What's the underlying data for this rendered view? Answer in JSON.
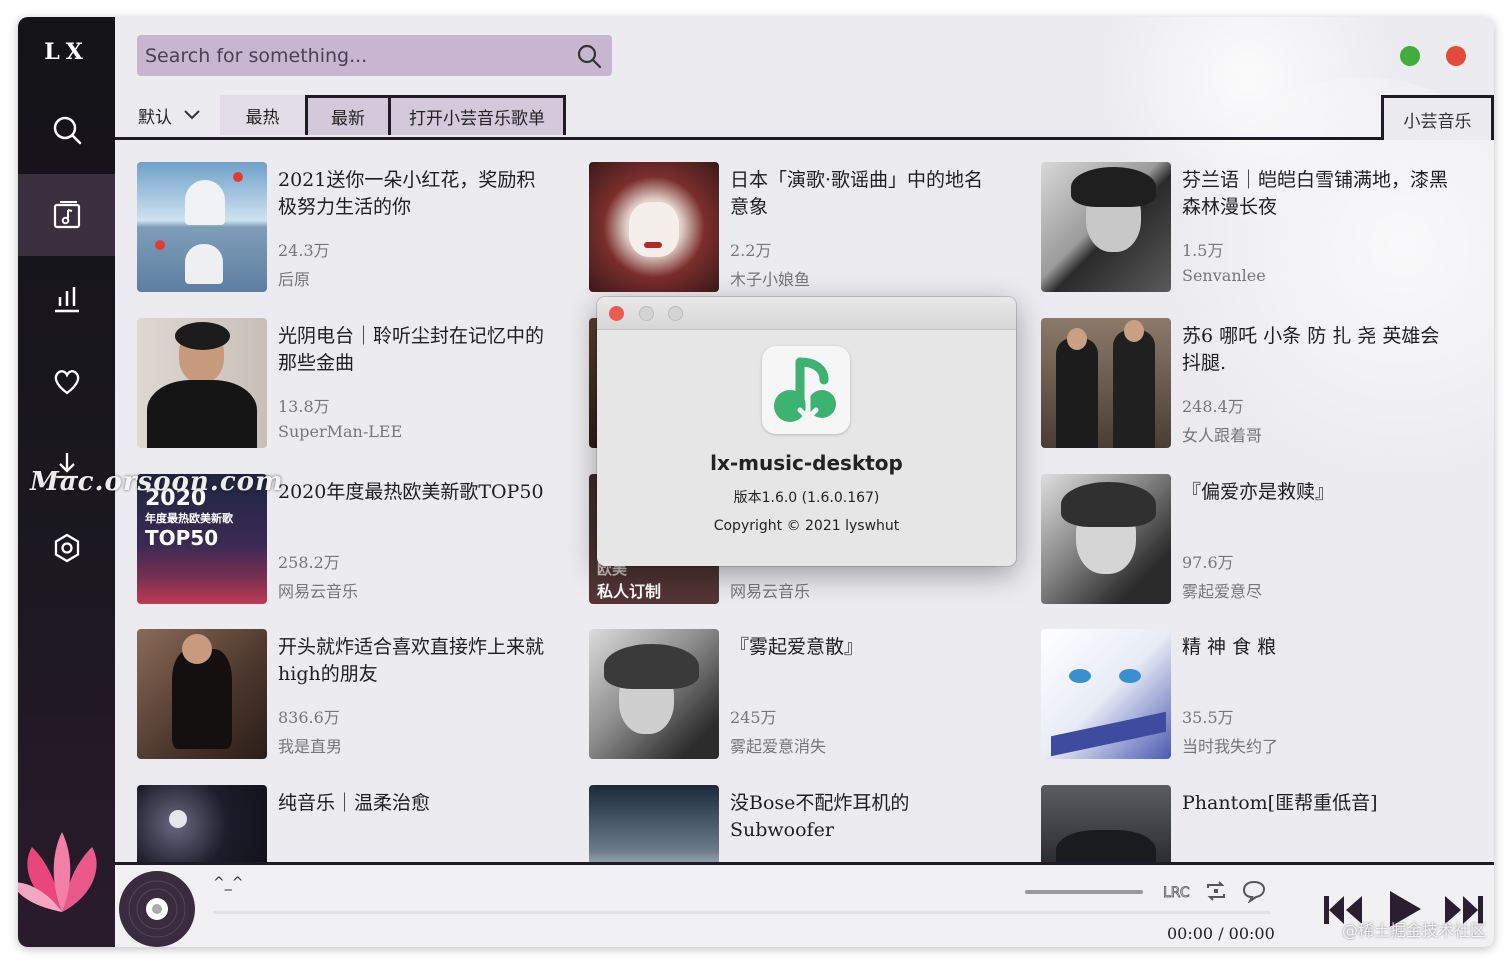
{
  "app": {
    "logo": "LX",
    "window_green": "#3fae3f",
    "window_red": "#e54b3c",
    "accent": "#c8b5cf"
  },
  "search": {
    "placeholder": "Search for something..."
  },
  "tabs": {
    "sort_label": "默认",
    "items": [
      {
        "label": "最热"
      },
      {
        "label": "最新"
      },
      {
        "label": "打开小芸音乐歌单"
      }
    ],
    "source": "小芸音乐"
  },
  "cards": [
    {
      "title": "2021送你一朵小红花，奖励积极努力生活的你",
      "count": "24.3万",
      "author": "后原"
    },
    {
      "title": "日本「演歌·歌谣曲」中的地名意象",
      "count": "2.2万",
      "author": "木子小娘鱼"
    },
    {
      "title": "芬兰语｜皑皑白雪铺满地，漆黑森林漫长夜",
      "count": "1.5万",
      "author": "Senvanlee"
    },
    {
      "title": "光阴电台｜聆听尘封在记忆中的那些金曲",
      "count": "13.8万",
      "author": "SuperMan-LEE"
    },
    {
      "title": "",
      "count": "",
      "author": ""
    },
    {
      "title": "苏6 哪吒 小条 防 扎 尧 英雄会 抖腿.",
      "count": "248.4万",
      "author": "女人跟着哥"
    },
    {
      "title": "2020年度最热欧美新歌TOP50",
      "count": "258.2万",
      "author": "网易云音乐",
      "thumb_text_1": "2020",
      "thumb_text_2": "年度最热欧美新歌",
      "thumb_text_3": "TOP50"
    },
    {
      "title": "",
      "count": "",
      "author": "网易云音乐",
      "thumb_text_1": "欧美",
      "thumb_text_2": "私人订制"
    },
    {
      "title": "『偏爱亦是救赎』",
      "count": "97.6万",
      "author": "雾起爱意尽"
    },
    {
      "title": "开头就炸适合喜欢直接炸上来就high的朋友",
      "count": "836.6万",
      "author": "我是直男"
    },
    {
      "title": "『雾起爱意散』",
      "count": "245万",
      "author": "雾起爱意消失"
    },
    {
      "title": "精 神 食 粮",
      "count": "35.5万",
      "author": "当时我失约了"
    },
    {
      "title": "纯音乐｜温柔治愈",
      "count": "",
      "author": ""
    },
    {
      "title": "没Bose不配炸耳机的Subwoofer",
      "count": "",
      "author": ""
    },
    {
      "title": "Phantom[匪帮重低音]",
      "count": "",
      "author": ""
    }
  ],
  "dialog": {
    "app_name": "lx-music-desktop",
    "version": "版本1.6.0 (1.6.0.167)",
    "copyright": "Copyright © 2021 lyswhut"
  },
  "player": {
    "song": "^_^",
    "time": "00:00 / 00:00",
    "lrc_label": "LRC"
  },
  "watermarks": {
    "left": "Mac.orsoon.com",
    "right": "@稀土掘金技术社区"
  }
}
